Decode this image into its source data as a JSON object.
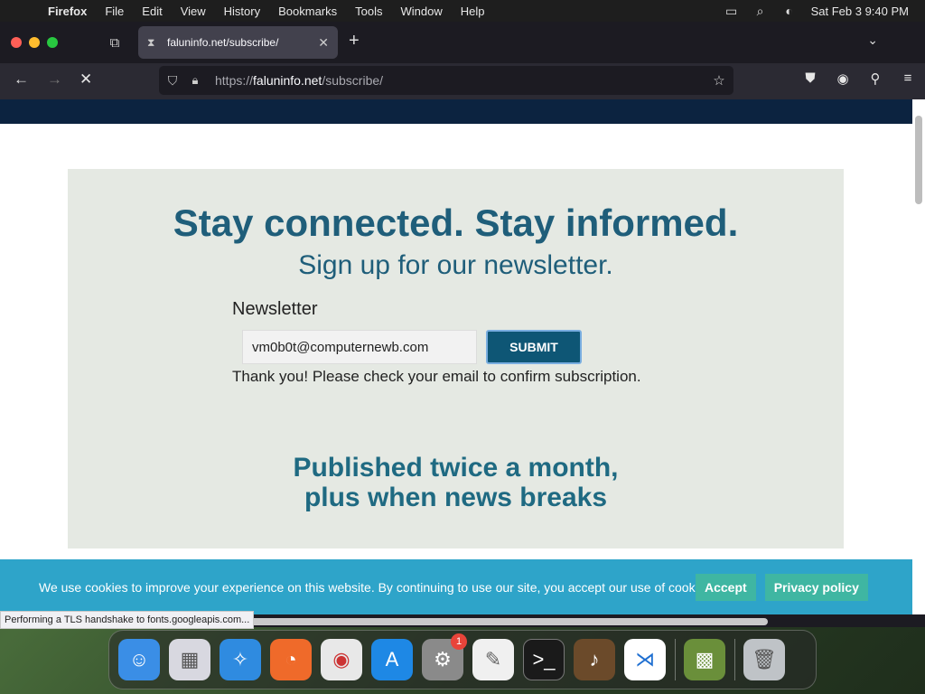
{
  "menubar": {
    "app_name": "Firefox",
    "menus": [
      "File",
      "Edit",
      "View",
      "History",
      "Bookmarks",
      "Tools",
      "Window",
      "Help"
    ],
    "clock": "Sat Feb 3  9:40 PM"
  },
  "browser": {
    "tab_title": "faluninfo.net/subscribe/",
    "url_prefix": "https://",
    "url_domain": "faluninfo.net",
    "url_path": "/subscribe/"
  },
  "page": {
    "headline": "Stay connected. Stay informed.",
    "subheadline": "Sign up for our newsletter.",
    "newsletter_label": "Newsletter",
    "email_value": "vm0b0t@computernewb.com",
    "submit_label": "SUBMIT",
    "thank_you": "Thank you! Please check your email to confirm subscription.",
    "published_line1": "Published twice a month,",
    "published_line2": "plus when news breaks"
  },
  "cookie": {
    "text": "We use cookies to improve your experience on this website. By continuing to use our site, you accept our use of cookies.",
    "accept_label": "Accept",
    "privacy_label": "Privacy policy"
  },
  "status": {
    "text": "Performing a TLS handshake to fonts.googleapis.com..."
  },
  "dock": {
    "system_settings_badge": "1"
  },
  "colors": {
    "site_header": "#0c2340",
    "box_bg": "#e5e9e3",
    "headline": "#1f5e7a",
    "submit_bg": "#0e5675",
    "cookie_bg": "#2ea4c9",
    "cookie_btn": "#3fb6a2"
  }
}
